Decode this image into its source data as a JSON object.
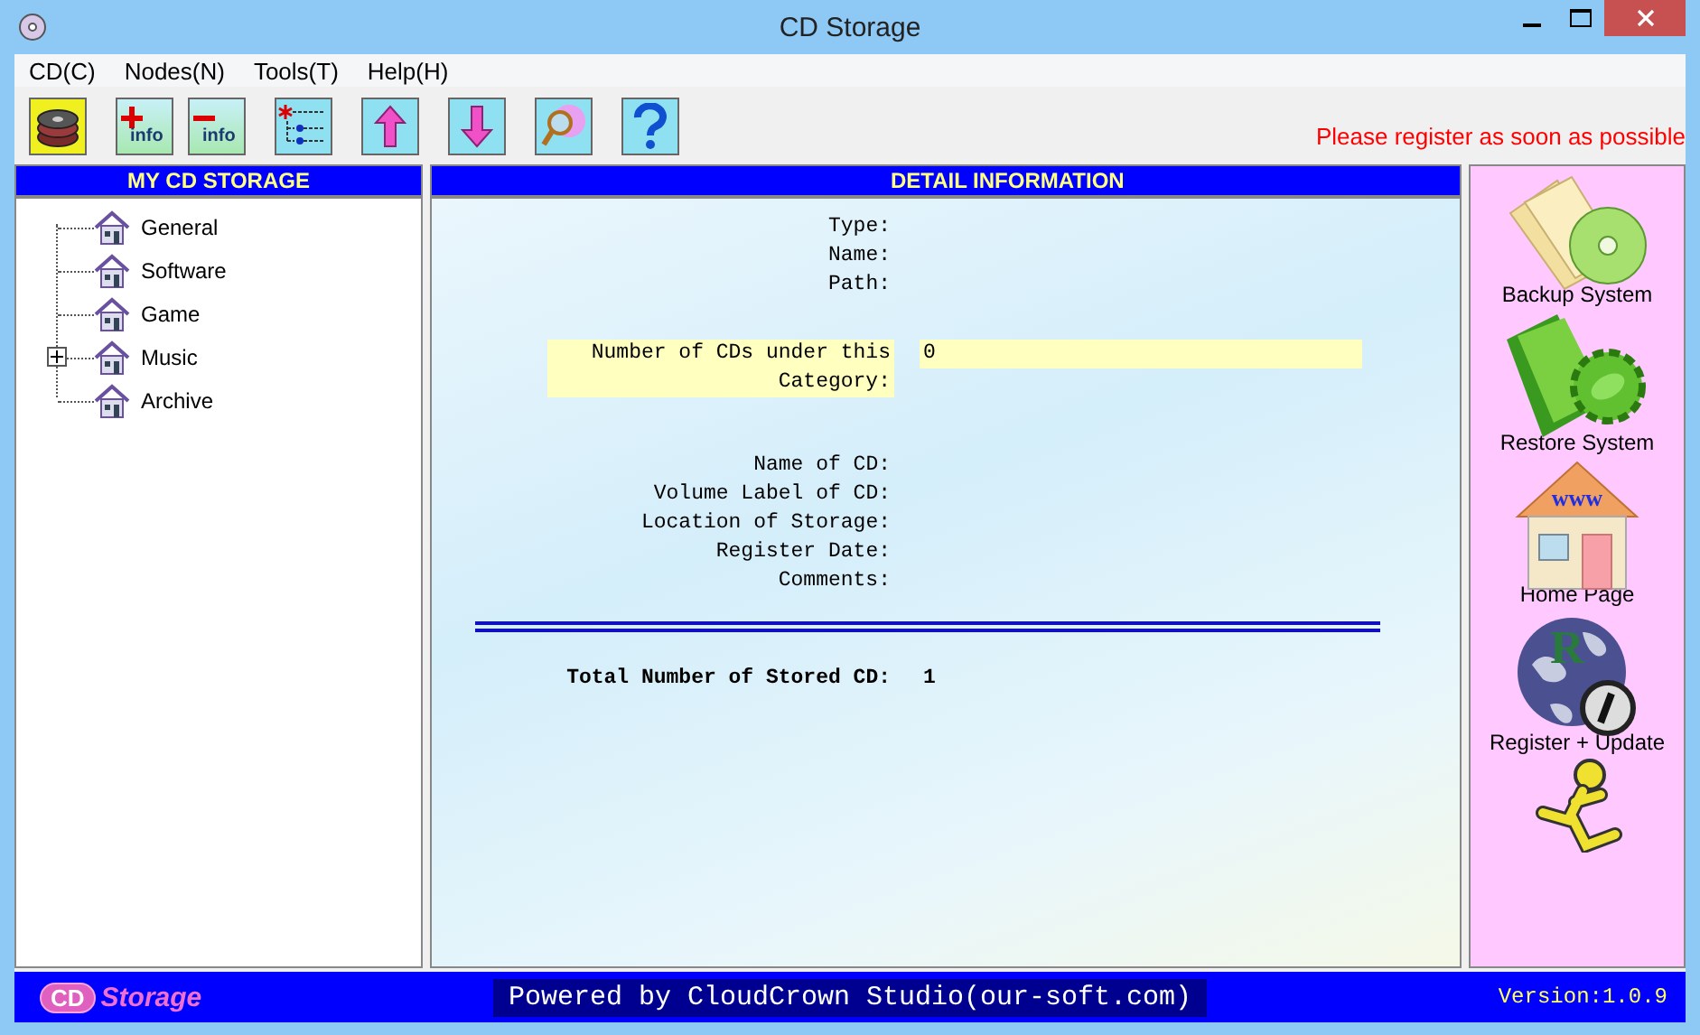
{
  "window": {
    "title": "CD Storage"
  },
  "menu": [
    "CD(C)",
    "Nodes(N)",
    "Tools(T)",
    "Help(H)"
  ],
  "toolbar": [
    {
      "kind": "discs"
    },
    {
      "kind": "add-info",
      "text": "info"
    },
    {
      "kind": "remove-info",
      "text": "info"
    },
    {
      "kind": "tree"
    },
    {
      "kind": "up"
    },
    {
      "kind": "down"
    },
    {
      "kind": "search"
    },
    {
      "kind": "help"
    }
  ],
  "notice": "Please register as soon as possible",
  "tree": {
    "title": "MY CD STORAGE",
    "items": [
      {
        "label": "General",
        "expandable": false
      },
      {
        "label": "Software",
        "expandable": false
      },
      {
        "label": "Game",
        "expandable": false
      },
      {
        "label": "Music",
        "expandable": true,
        "expanded": false
      },
      {
        "label": "Archive",
        "expandable": false
      }
    ]
  },
  "detail": {
    "title": "DETAIL INFORMATION",
    "groups": [
      [
        {
          "label": "Type:",
          "highlighted": false
        },
        {
          "label": "Name:",
          "highlighted": false
        },
        {
          "label": "Path:",
          "highlighted": false
        }
      ],
      [
        {
          "label": "Number of CDs under this Category:",
          "value": "0",
          "highlighted": true
        }
      ],
      [
        {
          "label": "Name of CD:",
          "highlighted": false
        },
        {
          "label": "Volume Label of CD:",
          "highlighted": false
        },
        {
          "label": "Location of Storage:",
          "highlighted": false
        },
        {
          "label": "Register Date:",
          "highlighted": false
        },
        {
          "label": "Comments:",
          "highlighted": false
        }
      ]
    ],
    "total": {
      "label": "Total Number of Stored CD:",
      "value": "1"
    }
  },
  "side_buttons": [
    {
      "kind": "backup",
      "label": "Backup System"
    },
    {
      "kind": "restore",
      "label": "Restore System"
    },
    {
      "kind": "home",
      "label": "Home Page",
      "icon_text": "www"
    },
    {
      "kind": "register",
      "label": "Register + Update",
      "icon_text": "R"
    },
    {
      "kind": "exit"
    }
  ],
  "footer": {
    "logo_mark": "CD",
    "logo_text": "Storage",
    "credit": "Powered by CloudCrown Studio(our-soft.com)",
    "version": "Version:1.0.9"
  }
}
